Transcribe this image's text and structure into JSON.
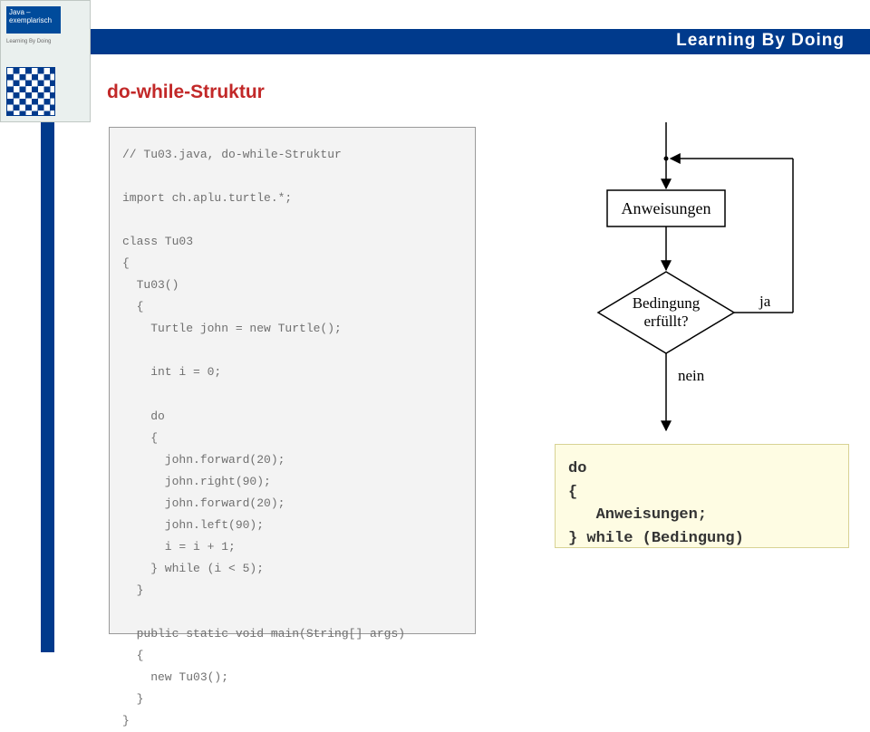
{
  "header": {
    "banner_title": "Learning By Doing"
  },
  "thumb": {
    "title": "Java –\nexemplarisch",
    "subtitle": "Learning By Doing"
  },
  "section_title": "do-while-Struktur",
  "code": "// Tu03.java, do-while-Struktur\n\nimport ch.aplu.turtle.*;\n\nclass Tu03\n{\n  Tu03()\n  {\n    Turtle john = new Turtle();\n\n    int i = 0;\n\n    do\n    {\n      john.forward(20);\n      john.right(90);\n      john.forward(20);\n      john.left(90);\n      i = i + 1;\n    } while (i < 5);\n  }\n\n  public static void main(String[] args)\n  {\n    new Tu03();\n  }\n}",
  "flowchart": {
    "block_label": "Anweisungen",
    "decision_line1": "Bedingung",
    "decision_line2": "erfüllt?",
    "yes_label": "ja",
    "no_label": "nein"
  },
  "syntax": "do\n{\n   Anweisungen;\n} while (Bedingung)"
}
